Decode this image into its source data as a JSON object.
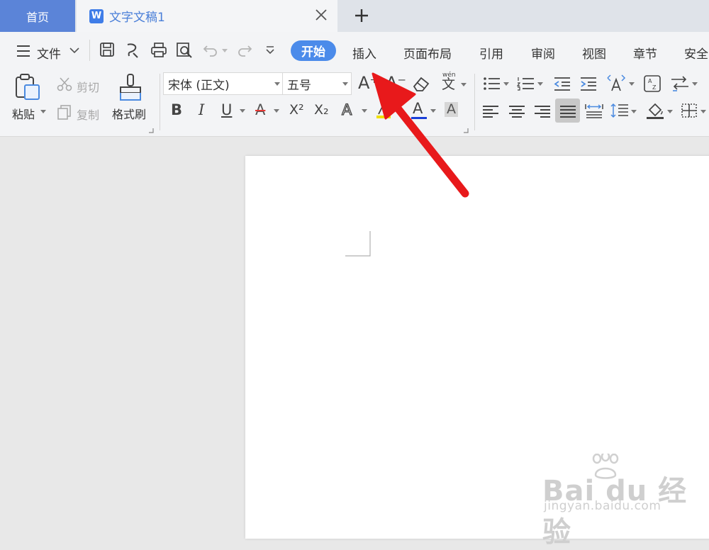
{
  "tabs": {
    "home": "首页",
    "document": {
      "logo": "W",
      "title": "文字文稿1"
    }
  },
  "menubar": {
    "file_label": "文件",
    "items": [
      "开始",
      "插入",
      "页面布局",
      "引用",
      "审阅",
      "视图",
      "章节",
      "安全"
    ],
    "active_item": "开始"
  },
  "ribbon": {
    "paste_label": "粘贴",
    "cut_label": "剪切",
    "copy_label": "复制",
    "format_painter_label": "格式刷",
    "font_name": "宋体 (正文)",
    "font_size": "五号",
    "wen_label": "文",
    "wen_pinyin": "wén",
    "bold": "B",
    "italic": "I",
    "underline": "U",
    "strike": "A",
    "superscript": "X²",
    "subscript": "X₂",
    "font_grow": "A⁺",
    "font_shrink": "A⁻",
    "text_effect": "A",
    "font_color": "A",
    "char_shading": "A",
    "sort_label": "A↓Z"
  },
  "watermark": {
    "brand": "Bai du 经验",
    "url": "jingyan.baidu.com"
  },
  "colors": {
    "accent": "#4b8bea",
    "home_tab": "#5b84d8",
    "arrow": "#e8191b",
    "font_color_bar": "#1a3fd8",
    "highlight_bar": "#f0e000"
  }
}
